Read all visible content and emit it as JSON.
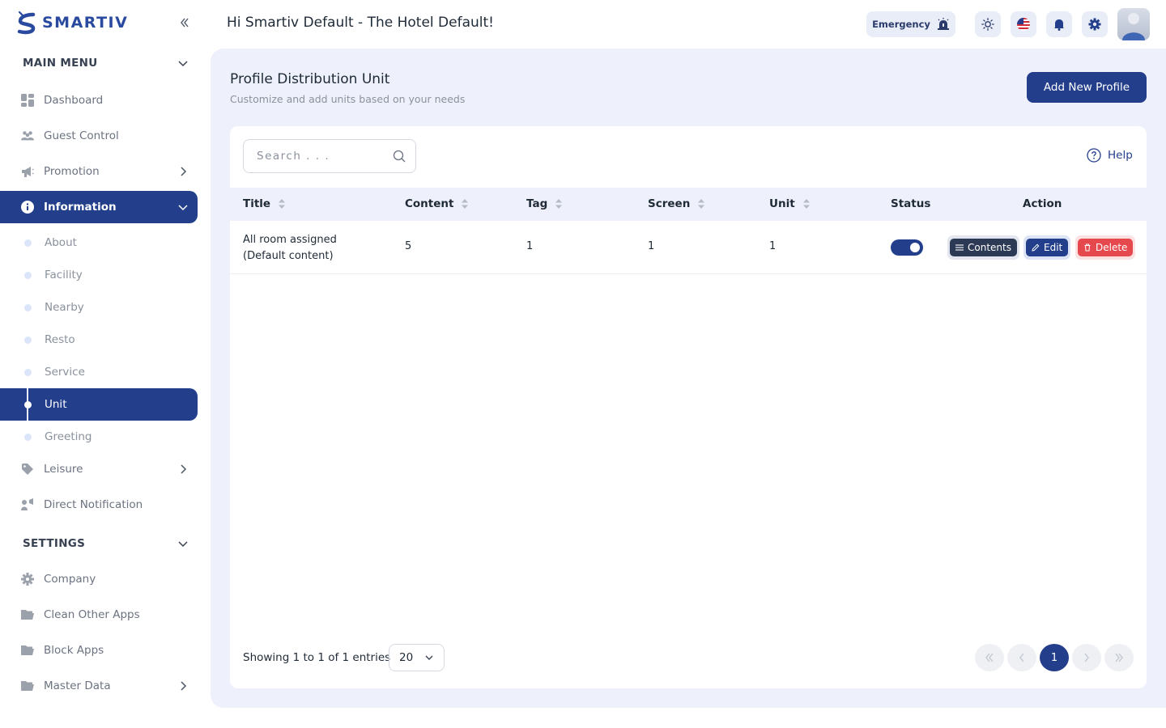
{
  "brand": {
    "name": "SMARTIV"
  },
  "header": {
    "greeting": "Hi Smartiv Default - The Hotel Default!",
    "emergency_label": "Emergency"
  },
  "sidebar": {
    "main_menu_label": "MAIN MENU",
    "items": [
      {
        "label": "Dashboard",
        "icon": "dashboard-icon"
      },
      {
        "label": "Guest Control",
        "icon": "guests-icon"
      },
      {
        "label": "Promotion",
        "icon": "megaphone-icon"
      },
      {
        "label": "Information",
        "icon": "info-icon"
      }
    ],
    "information_sub": [
      "About",
      "Facility",
      "Nearby",
      "Resto",
      "Service",
      "Unit",
      "Greeting"
    ],
    "items_after": [
      {
        "label": "Leisure",
        "icon": "tag-icon"
      },
      {
        "label": "Direct Notification",
        "icon": "notification-icon"
      }
    ],
    "settings_label": "SETTINGS",
    "settings_items": [
      {
        "label": "Company",
        "icon": "gear-icon"
      },
      {
        "label": "Clean Other Apps",
        "icon": "folder-icon"
      },
      {
        "label": "Block Apps",
        "icon": "folder-icon"
      },
      {
        "label": "Master Data",
        "icon": "folder-icon"
      }
    ],
    "active_sub": "Unit"
  },
  "page": {
    "title": "Profile Distribution Unit",
    "subtitle": "Customize and add units based on your needs",
    "add_button": "Add New Profile"
  },
  "toolbar": {
    "search_placeholder": "Search . . .",
    "help_label": "Help"
  },
  "table": {
    "columns": [
      "Title",
      "Content",
      "Tag",
      "Screen",
      "Unit",
      "Status",
      "Action"
    ],
    "rows": [
      {
        "title_line1": "All room assigned",
        "title_line2": "(Default content)",
        "content": "5",
        "tag": "1",
        "screen": "1",
        "unit": "1",
        "status": true
      }
    ],
    "actions": {
      "contents": "Contents",
      "edit": "Edit",
      "delete": "Delete"
    }
  },
  "footer": {
    "showing": "Showing 1 to 1 of 1 entries",
    "page_size": "20",
    "current_page": "1"
  },
  "colors": {
    "primary": "#233f8c",
    "panel_bg": "#eef1fc",
    "delete": "#e5484d",
    "contents": "#2d3a55"
  }
}
